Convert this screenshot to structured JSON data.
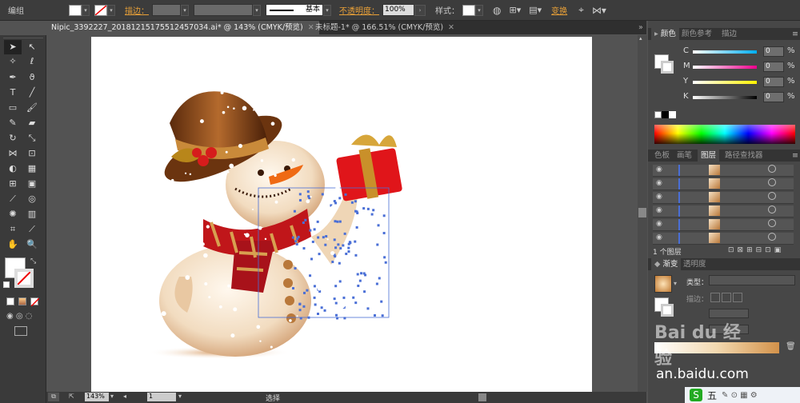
{
  "control_bar": {
    "group_label": "编组",
    "stroke_label": "描边：",
    "stroke_style": "基本",
    "opacity_label": "不透明度：",
    "opacity_value": "100%",
    "style_label": "样式：",
    "transform_label": "变换"
  },
  "tabs": [
    {
      "label": "Nipic_3392227_20181215175512457034.ai* @ 143% (CMYK/预览)"
    },
    {
      "label": "未标题-1* @ 166.51% (CMYK/预览)"
    }
  ],
  "color_panel": {
    "tabs": [
      "颜色",
      "颜色参考",
      "描边"
    ],
    "channels": [
      {
        "name": "C",
        "value": "0",
        "color": "#00aeef"
      },
      {
        "name": "M",
        "value": "0",
        "color": "#ec008c"
      },
      {
        "name": "Y",
        "value": "0",
        "color": "#fff200"
      },
      {
        "name": "K",
        "value": "0",
        "color": "#000000"
      }
    ],
    "pct_unit": "%"
  },
  "layers_panel": {
    "tabs": [
      "色板",
      "画笔",
      "图层",
      "路径查找器"
    ],
    "footer": "1 个图层"
  },
  "gradient_panel": {
    "tabs": [
      "渐变",
      "透明度"
    ],
    "type_label": "类型：",
    "stroke_label": "描边："
  },
  "status_bar": {
    "zoom": "143%",
    "page": "1",
    "mode": "选择"
  },
  "watermark": {
    "brand": "Bai du 经验",
    "url": "jingyan.baidu.com",
    "visible_url": "an.baidu.com"
  },
  "taskbar": {
    "items": [
      "S",
      "五"
    ]
  }
}
